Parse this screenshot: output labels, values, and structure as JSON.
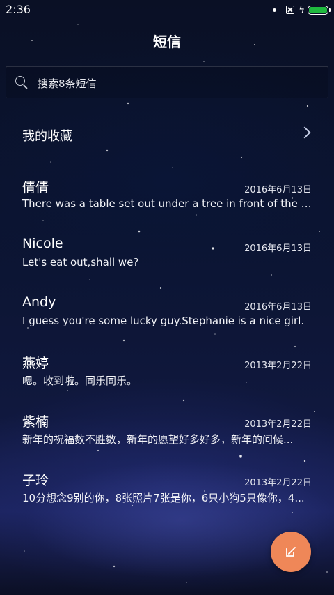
{
  "status_bar": {
    "time": "2:36",
    "battery_color": "#1fb93f"
  },
  "header": {
    "title": "短信"
  },
  "search": {
    "placeholder": "搜索8条短信",
    "icon": "search-icon"
  },
  "favorites": {
    "label": "我的收藏",
    "icon": "chevron-right-icon"
  },
  "conversations": [
    {
      "name": "倩倩",
      "date": "2016年6月13日",
      "preview": "There was a table set out under a tree in front of the ho..."
    },
    {
      "name": "Nicole",
      "date": "2016年6月13日",
      "preview": "Let's eat out,shall we?"
    },
    {
      "name": "Andy",
      "date": "2016年6月13日",
      "preview": "I guess you're some lucky guy.Stephanie is a nice girl."
    },
    {
      "name": "燕婷",
      "date": "2013年2月22日",
      "preview": "嗯。收到啦。同乐同乐。"
    },
    {
      "name": "紫楠",
      "date": "2013年2月22日",
      "preview": "新年的祝福数不胜数，新年的愿望好多好多，新年的问候..."
    },
    {
      "name": "子玲",
      "date": "2013年2月22日",
      "preview": "10分想念9别的你，8张照片7张是你，6只小狗5只像你，4..."
    }
  ],
  "compose": {
    "icon": "compose-icon",
    "color": "#ef8758"
  }
}
